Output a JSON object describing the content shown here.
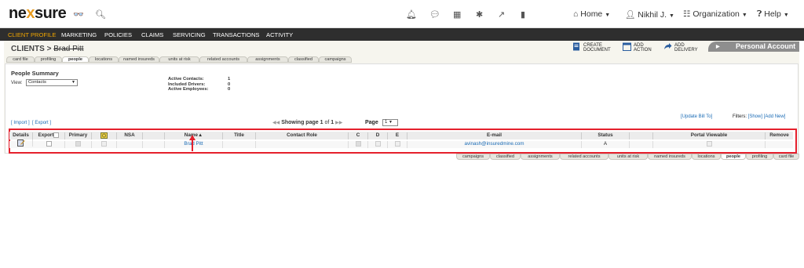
{
  "app": {
    "logo_text_pre": "ne",
    "logo_x": "x",
    "logo_text_post": "sure"
  },
  "topnav": {
    "home": "Home",
    "user": "Nikhil J.",
    "organization": "Organization",
    "help": "Help"
  },
  "mainnav": [
    "CLIENT PROFILE",
    "MARKETING",
    "POLICIES",
    "CLAIMS",
    "SERVICING",
    "TRANSACTIONS",
    "ACTIVITY"
  ],
  "header": {
    "section": "CLIENTS",
    "separator": ">",
    "client_name": "Brad Pitt",
    "actions": {
      "create_document": "CREATE DOCUMENT",
      "add_action": "ADD ACTION",
      "add_delivery": "ADD DELIVERY"
    },
    "account_tab": "Personal Account"
  },
  "top_tabs": [
    "card file",
    "profiling",
    "people",
    "locations",
    "named insureds",
    "units at risk",
    "related accounts",
    "assignments",
    "classified",
    "campaigns"
  ],
  "bottom_tabs": [
    "campaigns",
    "classified",
    "assignments",
    "related accounts",
    "units at risk",
    "named insureds",
    "locations",
    "people",
    "profiling",
    "card file"
  ],
  "people_summary": {
    "title": "People Summary",
    "view_label": "View:",
    "view_value": "Contacts",
    "stats": [
      {
        "label": "Active Contacts:",
        "value": "1"
      },
      {
        "label": "Included Drivers:",
        "value": "0"
      },
      {
        "label": "Active Employees:",
        "value": "0"
      }
    ],
    "import": "[ Import ]",
    "export": "[ Export ]",
    "paging_text": "Showing page",
    "page_num": "1",
    "of": "of",
    "page_total": "1",
    "page_label": "Page",
    "page_value": "1",
    "update_bill": "[Update Bill To]",
    "filters_label": "Filters:",
    "filters_show": "[Show]",
    "filters_add": "[Add New]"
  },
  "grid": {
    "columns": [
      "Details",
      "Export",
      "Primary",
      "",
      "NSA",
      "",
      "Name▲",
      "Title",
      "Contact Role",
      "C",
      "D",
      "E",
      "E-mail",
      "Status",
      "",
      "Portal Viewable",
      "Remove"
    ],
    "rows": [
      {
        "name": "Brad Pitt",
        "email": "avinash@insuredmine.com",
        "status": "A"
      }
    ]
  },
  "colors": {
    "accent": "#f0a500",
    "nav_bg": "#2e2e2e",
    "highlight": "#e5202c",
    "link": "#1a6bb5"
  }
}
